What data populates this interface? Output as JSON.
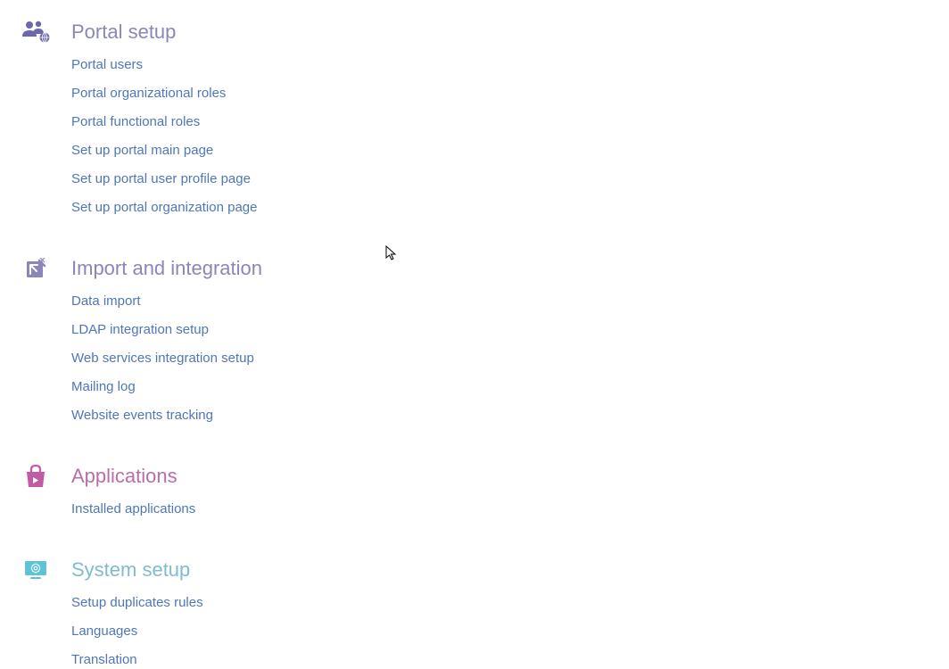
{
  "sections": {
    "portal": {
      "title": "Portal setup",
      "links": [
        "Portal users",
        "Portal organizational roles",
        "Portal functional roles",
        "Set up portal main page",
        "Set up portal user profile page",
        "Set up portal organization page"
      ]
    },
    "import": {
      "title": "Import and integration",
      "links": [
        "Data import",
        "LDAP integration setup",
        "Web services integration setup",
        "Mailing log",
        "Website events tracking"
      ]
    },
    "applications": {
      "title": "Applications",
      "links": [
        "Installed applications"
      ]
    },
    "system": {
      "title": "System setup",
      "links": [
        "Setup duplicates rules",
        "Languages",
        "Translation"
      ]
    }
  }
}
